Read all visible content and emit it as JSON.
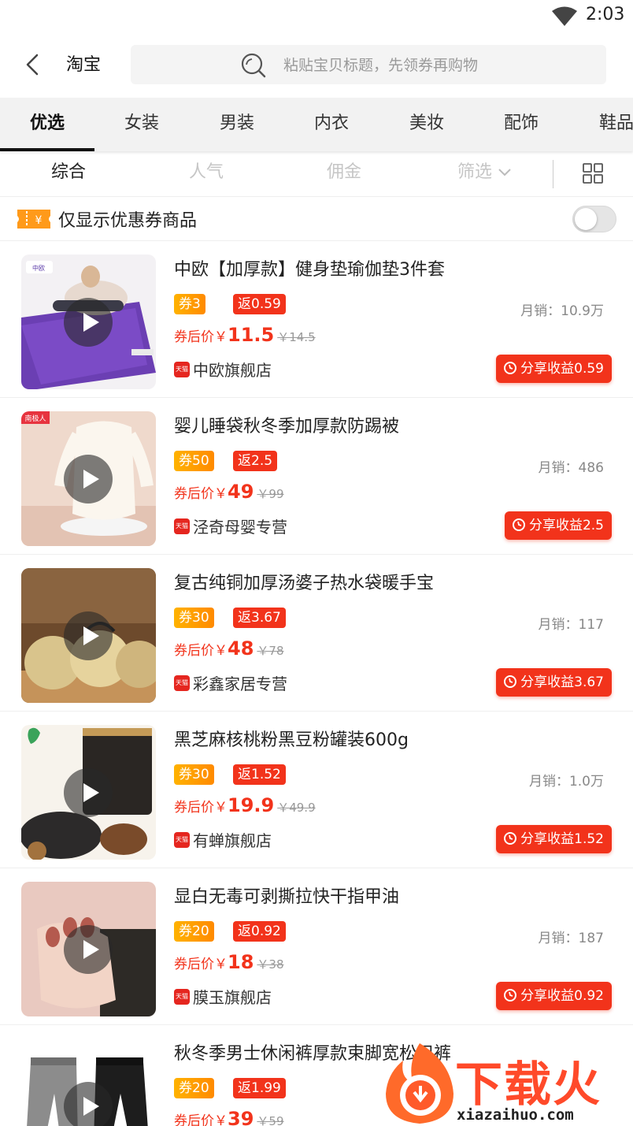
{
  "status": {
    "time": "2:03"
  },
  "header": {
    "title": "淘宝",
    "search_placeholder": "粘贴宝贝标题，先领券再购物"
  },
  "categories": [
    {
      "label": "优选",
      "active": true
    },
    {
      "label": "女装"
    },
    {
      "label": "男装"
    },
    {
      "label": "内衣"
    },
    {
      "label": "美妆"
    },
    {
      "label": "配饰"
    },
    {
      "label": "鞋品"
    }
  ],
  "sort": {
    "items": [
      "综合",
      "人气",
      "佣金",
      "筛选"
    ],
    "active": "综合"
  },
  "coupon_filter": {
    "label": "仅显示优惠券商品",
    "enabled": false
  },
  "products": [
    {
      "title": "中欧【加厚款】健身垫瑜伽垫3件套",
      "coupon": "券3",
      "rebate": "返0.59",
      "sales": "月销：10.9万",
      "price_label": "券后价￥",
      "price": "11.5",
      "orig": "￥14.5",
      "shop": "中欧旗舰店",
      "share": "分享收益0.59"
    },
    {
      "title": "婴儿睡袋秋冬季加厚款防踢被",
      "coupon": "券50",
      "rebate": "返2.5",
      "sales": "月销：486",
      "price_label": "券后价￥",
      "price": "49",
      "orig": "￥99",
      "shop": "泾奇母婴专营",
      "share": "分享收益2.5"
    },
    {
      "title": "复古纯铜加厚汤婆子热水袋暖手宝",
      "coupon": "券30",
      "rebate": "返3.67",
      "sales": "月销：117",
      "price_label": "券后价￥",
      "price": "48",
      "orig": "￥78",
      "shop": "彩鑫家居专营",
      "share": "分享收益3.67"
    },
    {
      "title": "黑芝麻核桃粉黑豆粉罐装600g",
      "coupon": "券30",
      "rebate": "返1.52",
      "sales": "月销：1.0万",
      "price_label": "券后价￥",
      "price": "19.9",
      "orig": "￥49.9",
      "shop": "有蝉旗舰店",
      "share": "分享收益1.52"
    },
    {
      "title": "显白无毒可剥撕拉快干指甲油",
      "coupon": "券20",
      "rebate": "返0.92",
      "sales": "月销：187",
      "price_label": "券后价￥",
      "price": "18",
      "orig": "￥38",
      "shop": "膜玉旗舰店",
      "share": "分享收益0.92"
    },
    {
      "title": "秋冬季男士休闲裤厚款束脚宽松卫裤",
      "coupon": "券20",
      "rebate": "返1.99",
      "sales": "",
      "price_label": "券后价￥",
      "price": "39",
      "orig": "￥59",
      "shop": "",
      "share": ""
    }
  ],
  "watermark": {
    "brand": "下载火",
    "url": "xiazaihuo.com"
  },
  "colors": {
    "accent_red": "#f2331b",
    "coupon_orange": "#ff9a00",
    "tab_bg": "#f2f2f2"
  }
}
